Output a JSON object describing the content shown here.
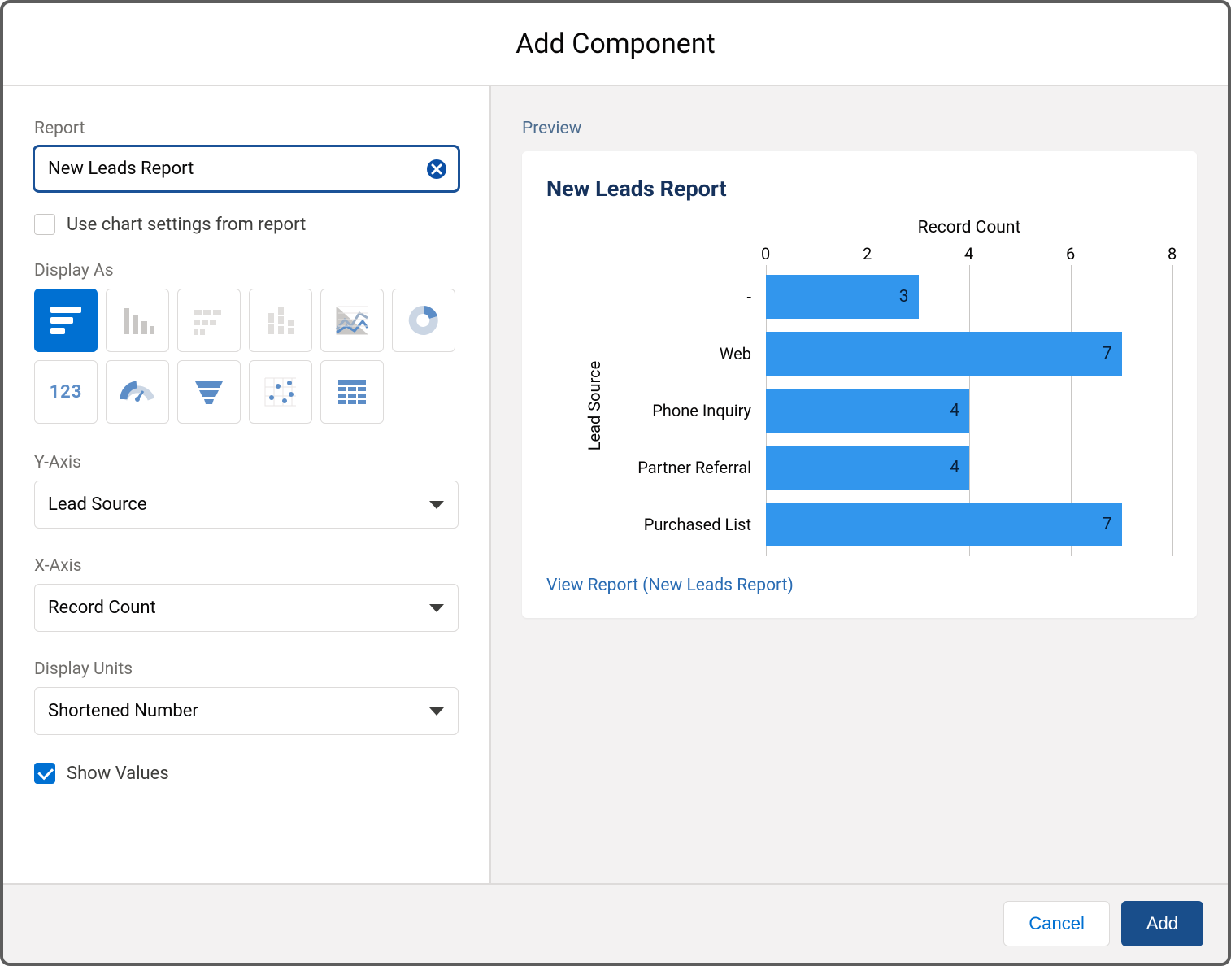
{
  "modal": {
    "title": "Add Component"
  },
  "form": {
    "report_label": "Report",
    "report_value": "New Leads Report",
    "use_chart_settings_label": "Use chart settings from report",
    "use_chart_settings_checked": false,
    "display_as_label": "Display As",
    "display_as_selected": "horizontal-bar",
    "y_axis_label": "Y-Axis",
    "y_axis_value": "Lead Source",
    "x_axis_label": "X-Axis",
    "x_axis_value": "Record Count",
    "display_units_label": "Display Units",
    "display_units_value": "Shortened Number",
    "show_values_label": "Show Values",
    "show_values_checked": true,
    "metric_text": "123"
  },
  "preview": {
    "label": "Preview",
    "chart_title": "New Leads Report",
    "x_axis_title": "Record Count",
    "y_axis_title": "Lead Source",
    "ticks": [
      "0",
      "2",
      "4",
      "6",
      "8"
    ],
    "view_report_link": "View Report (New Leads Report)"
  },
  "footer": {
    "cancel": "Cancel",
    "add": "Add"
  },
  "chart_data": {
    "type": "bar",
    "orientation": "horizontal",
    "title": "New Leads Report",
    "xlabel": "Record Count",
    "ylabel": "Lead Source",
    "xlim": [
      0,
      8
    ],
    "categories": [
      "-",
      "Web",
      "Phone Inquiry",
      "Partner Referral",
      "Purchased List"
    ],
    "values": [
      3,
      7,
      4,
      4,
      7
    ]
  }
}
